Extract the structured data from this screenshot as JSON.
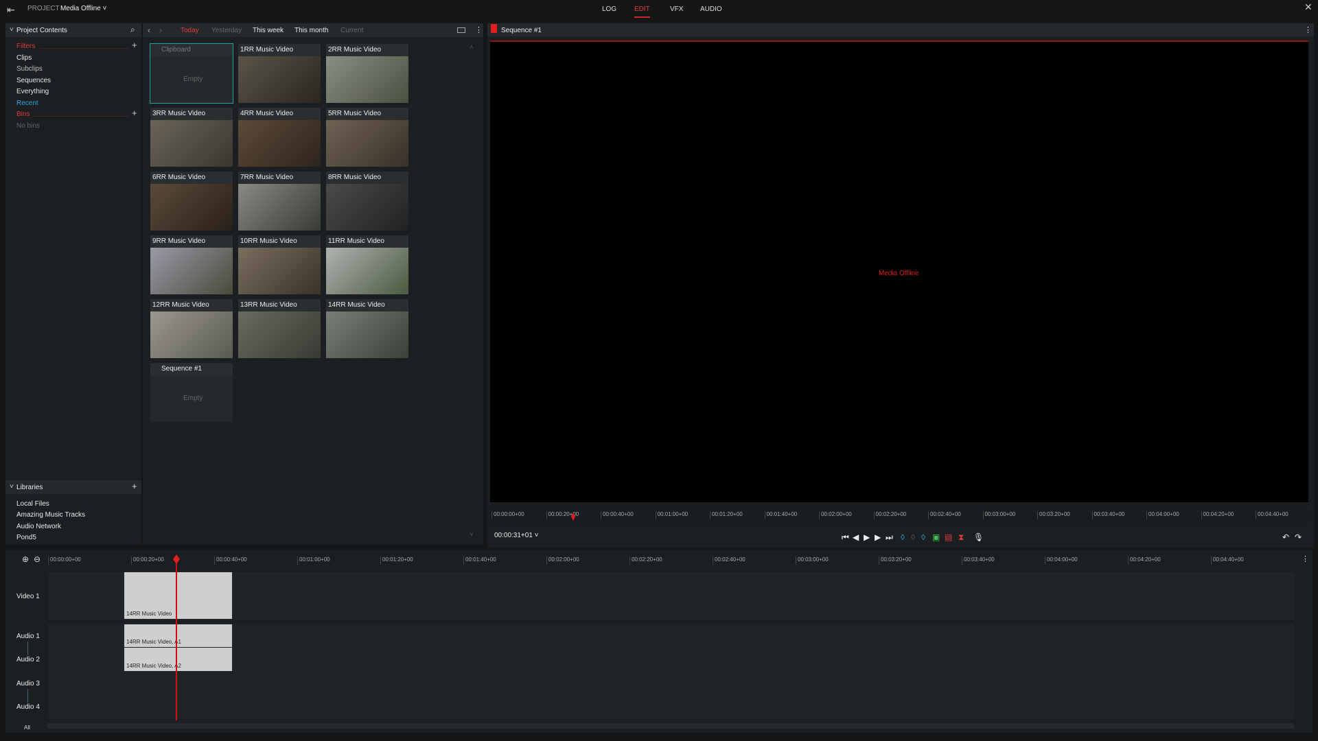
{
  "topbar": {
    "project_label": "PROJECT",
    "project_name": "Media Offline",
    "tabs": [
      {
        "label": "LOG"
      },
      {
        "label": "EDIT",
        "active": true
      },
      {
        "label": "VFX"
      },
      {
        "label": "AUDIO"
      }
    ]
  },
  "sidebar": {
    "title": "Project Contents",
    "filters_label": "Filters",
    "filters": [
      "Clips",
      "Subclips",
      "Sequences",
      "Everything",
      "Recent"
    ],
    "bins_label": "Bins",
    "bins_empty": "No bins",
    "libraries_label": "Libraries",
    "libraries": [
      "Local Files",
      "Amazing Music Tracks",
      "Audio Network",
      "Pond5"
    ]
  },
  "browser": {
    "date_tabs": [
      "Today",
      "Yesterday",
      "This week",
      "This month",
      "Current"
    ],
    "items": [
      {
        "title": "Clipboard",
        "empty": "Empty",
        "flag": true
      },
      {
        "title": "1RR Music Video"
      },
      {
        "title": "2RR Music Video"
      },
      {
        "title": "3RR Music Video"
      },
      {
        "title": "4RR Music Video"
      },
      {
        "title": "5RR Music Video"
      },
      {
        "title": "6RR Music Video"
      },
      {
        "title": "7RR Music Video"
      },
      {
        "title": "8RR Music Video"
      },
      {
        "title": "9RR Music Video"
      },
      {
        "title": "10RR Music Video"
      },
      {
        "title": "11RR Music Video"
      },
      {
        "title": "12RR Music Video"
      },
      {
        "title": "13RR Music Video"
      },
      {
        "title": "14RR Music Video"
      },
      {
        "title": "Sequence #1",
        "empty": "Empty",
        "flag": true
      }
    ]
  },
  "viewer": {
    "title": "Sequence #1",
    "status": "Media Offline",
    "timecode": "00:00:31+01",
    "ruler": [
      "00:00:00+00",
      "00:00:20+00",
      "00:00:40+00",
      "00:01:00+00",
      "00:01:20+00",
      "00:01:40+00",
      "00:02:00+00",
      "00:02:20+00",
      "00:02:40+00",
      "00:03:00+00",
      "00:03:20+00",
      "00:03:40+00",
      "00:04:00+00",
      "00:04:20+00",
      "00:04:40+00"
    ]
  },
  "timeline": {
    "tracks": [
      "Video 1",
      "Audio 1",
      "Audio 2",
      "Audio 3",
      "Audio 4"
    ],
    "all_label": "All",
    "clips": {
      "video": "14RR Music Video",
      "a1": "14RR Music Video, A1",
      "a2": "14RR Music Video, A2"
    }
  },
  "colors": {
    "accent": "#e03a3a",
    "selection": "#19a3a8",
    "link": "#2fa6e0"
  }
}
